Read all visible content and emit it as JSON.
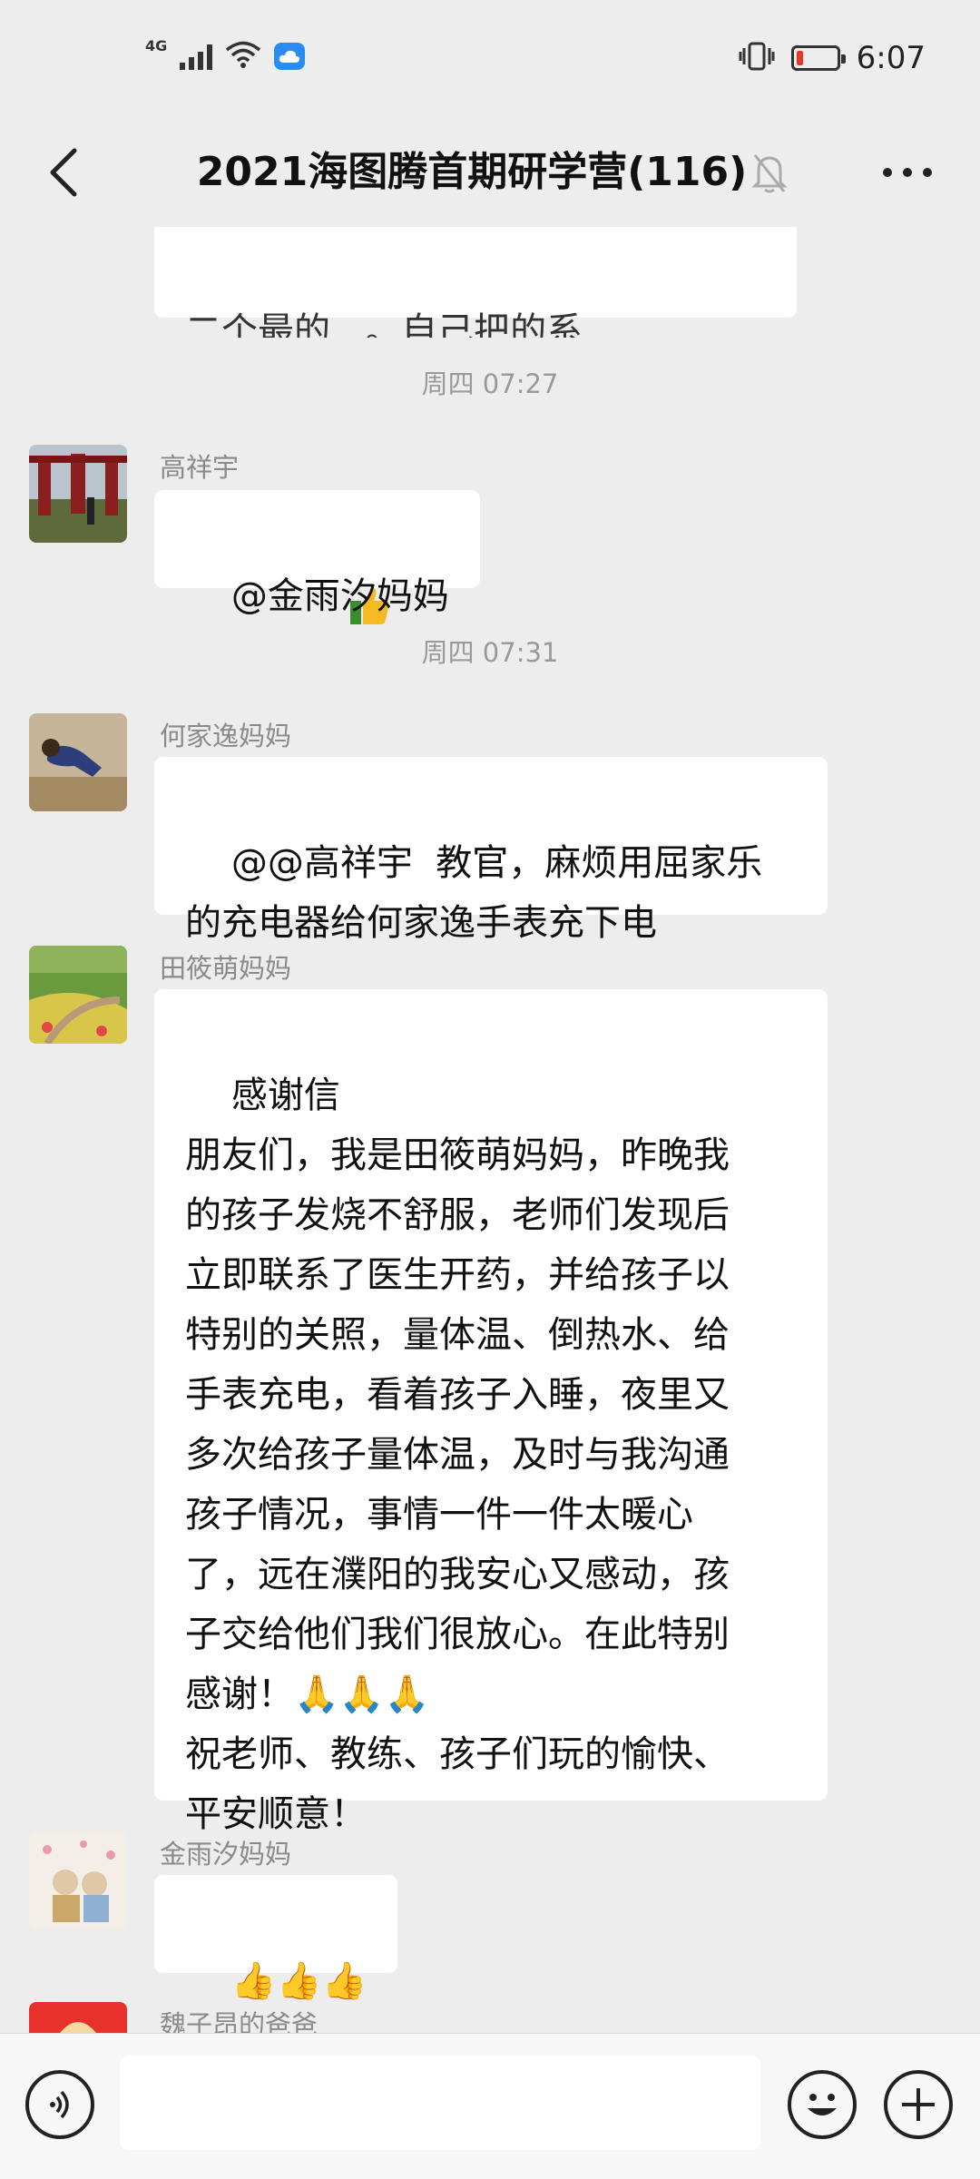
{
  "status_bar": {
    "network": "4G",
    "time": "6:07"
  },
  "header": {
    "title": "2021海图腾首期研学营(116)"
  },
  "messages": [
    {
      "type": "partial",
      "text": "二个最的...。自己把的系"
    },
    {
      "type": "time",
      "text": "周四 07:27"
    },
    {
      "type": "message",
      "sender": "高祥宇",
      "text": "@金雨汐妈妈"
    },
    {
      "type": "time",
      "text": "周四 07:31"
    },
    {
      "type": "message",
      "sender": "何家逸妈妈",
      "text": "@@高祥宇  教官，麻烦用屈家乐\n的充电器给何家逸手表充下电"
    },
    {
      "type": "message",
      "sender": "田筱萌妈妈",
      "text": "感谢信\n朋友们，我是田筱萌妈妈，昨晚我\n的孩子发烧不舒服，老师们发现后\n立即联系了医生开药，并给孩子以\n特别的关照，量体温、倒热水、给\n手表充电，看着孩子入睡，夜里又\n多次给孩子量体温，及时与我沟通\n孩子情况，事情一件一件太暖心\n了，远在濮阳的我安心又感动，孩\n子交给他们我们很放心。在此特别\n感谢！🙏🙏🙏\n祝老师、教练、孩子们玩的愉快、\n平安顺意！"
    },
    {
      "type": "message",
      "sender": "金雨汐妈妈",
      "text": "👍👍👍"
    },
    {
      "type": "message",
      "sender": "魏子昂的爸爸",
      "text": ""
    }
  ],
  "icons": {
    "back": "back-arrow-icon",
    "mute": "mute-bell-icon",
    "more": "more-icon",
    "voice": "voice-icon",
    "emoji": "emoji-icon",
    "plus": "plus-icon"
  },
  "colors": {
    "background": "#ededed",
    "bubble": "#ffffff",
    "battery_low": "#e23b2d"
  }
}
